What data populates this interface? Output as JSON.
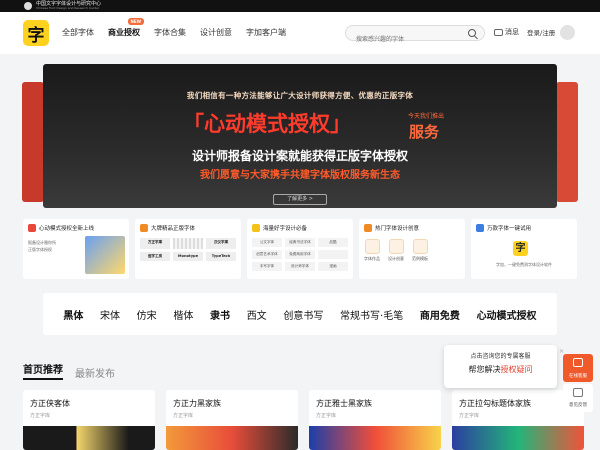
{
  "topbar": {
    "org_name": "中国文字字体设计与研究中心",
    "org_name_en": "Chinese Font Design and Research Center"
  },
  "header": {
    "brand_glyph": "字",
    "nav": [
      {
        "label": "全部字体"
      },
      {
        "label": "商业授权",
        "badge": "NEW"
      },
      {
        "label": "字体合集"
      },
      {
        "label": "设计创意"
      },
      {
        "label": "字加客户端"
      }
    ],
    "search_placeholder": "搜索感兴趣的字体",
    "messages": "消息",
    "login": "登录/注册"
  },
  "banner": {
    "line1": "我们相信有一种方法能够让广大设计师获得方便、优惠的正版字体",
    "headline": "「心动模式授权」",
    "tag": "今天我们推出",
    "service": "服务",
    "line3": "设计师报备设计案就能获得正版字体授权",
    "line4": "我们愿意与大家携手共建字体版权服务新生态",
    "cta": "了解更多 >"
  },
  "features": [
    {
      "title": "心动模式授权全新上线",
      "body": [
        "报备设计雅你所",
        "正版字体授权"
      ]
    },
    {
      "title": "大牌精品正版字体",
      "chips": [
        "方正字库",
        "",
        "汉仪字库",
        "造字工房",
        "Monotype",
        "TypeTech"
      ]
    },
    {
      "title": "海量好字设计必备",
      "chips": [
        "公文字体",
        "经典书法字体",
        "品酷",
        "创意艺术字体",
        "免费商用字体",
        "",
        "手写字体",
        "设计师字体",
        "漫画"
      ]
    },
    {
      "title": "热门字体设计创意",
      "tools": [
        "字体作品",
        "设计创意",
        "范例模板"
      ]
    },
    {
      "title": "万款字体一键试用",
      "glyph": "字",
      "desc": "字加，一键免费测字体设计软件"
    }
  ],
  "strip": [
    "黑体",
    "宋体",
    "仿宋",
    "楷体",
    "隶书",
    "西文",
    "创意书写",
    "常规书写·毛笔",
    "商用免费",
    "心动模式授权"
  ],
  "tabs": [
    {
      "label": "首页推荐"
    },
    {
      "label": "最新发布"
    }
  ],
  "cards": [
    {
      "title": "方正侠客体",
      "sub": "方正字库"
    },
    {
      "title": "方正力黑家族",
      "sub": "方正字库"
    },
    {
      "title": "方正雅士黑家族",
      "sub": "方正字库"
    },
    {
      "title": "方正拉勾标题体家族",
      "sub": "方正字库"
    }
  ],
  "popup": {
    "line1": "点击咨询您的专属客服",
    "line2_pre": "帮您解决",
    "line2_hl": "授权疑问",
    "close": "×"
  },
  "float": {
    "service": "在线客服",
    "feedback": "意见反馈"
  },
  "colors": {
    "accent": "#f05a2a",
    "brand_yellow": "#ffd21f",
    "banner_red": "#ff3b2c"
  }
}
